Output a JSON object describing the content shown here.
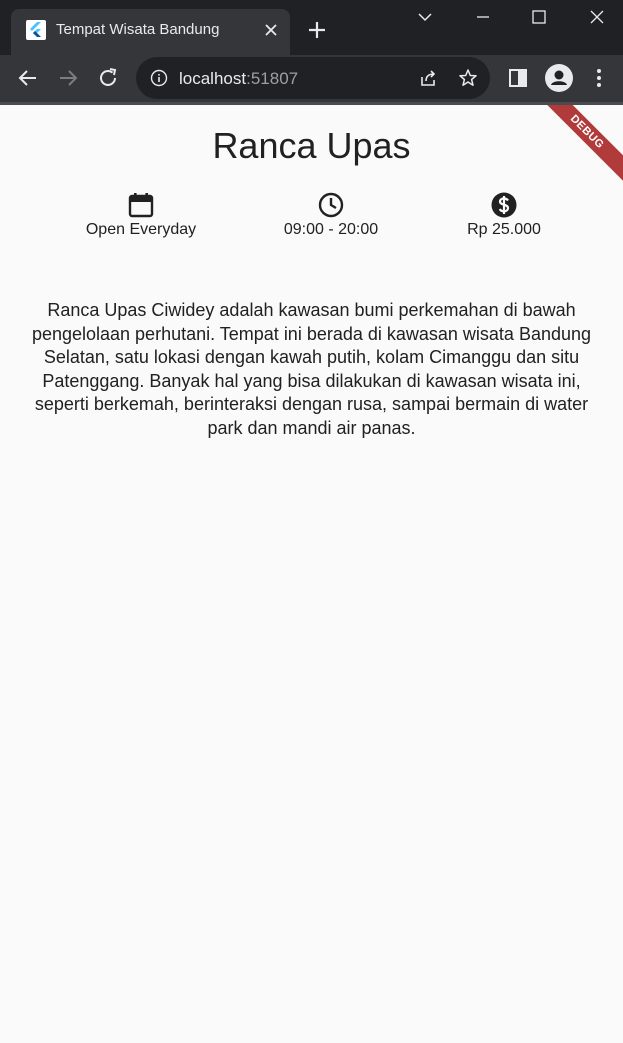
{
  "browser": {
    "tab_title": "Tempat Wisata Bandung",
    "url_host": "localhost",
    "url_port": ":51807"
  },
  "page": {
    "title": "Ranca Upas",
    "info": [
      {
        "icon": "calendar-icon",
        "label": "Open Everyday"
      },
      {
        "icon": "clock-icon",
        "label": "09:00 - 20:00"
      },
      {
        "icon": "dollar-icon",
        "label": "Rp 25.000"
      }
    ],
    "description": "Ranca Upas Ciwidey adalah kawasan bumi perkemahan di bawah pengelolaan perhutani. Tempat ini berada di kawasan wisata Bandung Selatan, satu lokasi dengan kawah putih, kolam Cimanggu dan situ Patenggang. Banyak hal yang bisa dilakukan di kawasan wisata ini, seperti berkemah, berinteraksi dengan rusa, sampai bermain di water park dan mandi air panas.",
    "debug_banner": "DEBUG"
  },
  "colors": {
    "chrome_dark": "#202124",
    "chrome_tab": "#35363a",
    "page_bg": "#fafafa",
    "text": "#212121",
    "debug_banner": "#b13b3b"
  }
}
